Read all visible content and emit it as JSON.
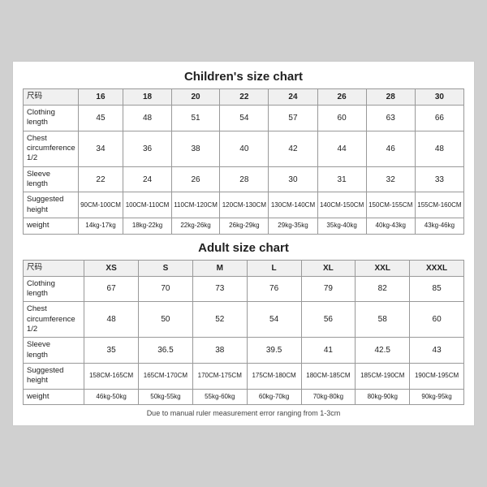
{
  "children_title": "Children's size chart",
  "adult_title": "Adult size chart",
  "footnote": "Due to manual ruler measurement error ranging from 1-3cm",
  "children": {
    "columns": [
      "尺码",
      "16",
      "18",
      "20",
      "22",
      "24",
      "26",
      "28",
      "30"
    ],
    "rows": [
      {
        "label": "Clothing\nlength",
        "values": [
          "45",
          "48",
          "51",
          "54",
          "57",
          "60",
          "63",
          "66"
        ]
      },
      {
        "label": "Chest\ncircumference\n1/2",
        "values": [
          "34",
          "36",
          "38",
          "40",
          "42",
          "44",
          "46",
          "48"
        ]
      },
      {
        "label": "Sleeve\nlength",
        "values": [
          "22",
          "24",
          "26",
          "28",
          "30",
          "31",
          "32",
          "33"
        ]
      },
      {
        "label": "Suggested\nheight",
        "values": [
          "90CM-100CM",
          "100CM-110CM",
          "110CM-120CM",
          "120CM-130CM",
          "130CM-140CM",
          "140CM-150CM",
          "150CM-155CM",
          "155CM-160CM"
        ]
      },
      {
        "label": "weight",
        "values": [
          "14kg-17kg",
          "18kg-22kg",
          "22kg-26kg",
          "26kg-29kg",
          "29kg-35kg",
          "35kg-40kg",
          "40kg-43kg",
          "43kg-46kg"
        ]
      }
    ]
  },
  "adult": {
    "columns": [
      "尺码",
      "XS",
      "S",
      "M",
      "L",
      "XL",
      "XXL",
      "XXXL"
    ],
    "rows": [
      {
        "label": "Clothing\nlength",
        "values": [
          "67",
          "70",
          "73",
          "76",
          "79",
          "82",
          "85"
        ]
      },
      {
        "label": "Chest\ncircumference\n1/2",
        "values": [
          "48",
          "50",
          "52",
          "54",
          "56",
          "58",
          "60"
        ]
      },
      {
        "label": "Sleeve\nlength",
        "values": [
          "35",
          "36.5",
          "38",
          "39.5",
          "41",
          "42.5",
          "43"
        ]
      },
      {
        "label": "Suggested\nheight",
        "values": [
          "158CM-165CM",
          "165CM-170CM",
          "170CM-175CM",
          "175CM-180CM",
          "180CM-185CM",
          "185CM-190CM",
          "190CM-195CM"
        ]
      },
      {
        "label": "weight",
        "values": [
          "46kg-50kg",
          "50kg-55kg",
          "55kg-60kg",
          "60kg-70kg",
          "70kg-80kg",
          "80kg-90kg",
          "90kg-95kg"
        ]
      }
    ]
  }
}
